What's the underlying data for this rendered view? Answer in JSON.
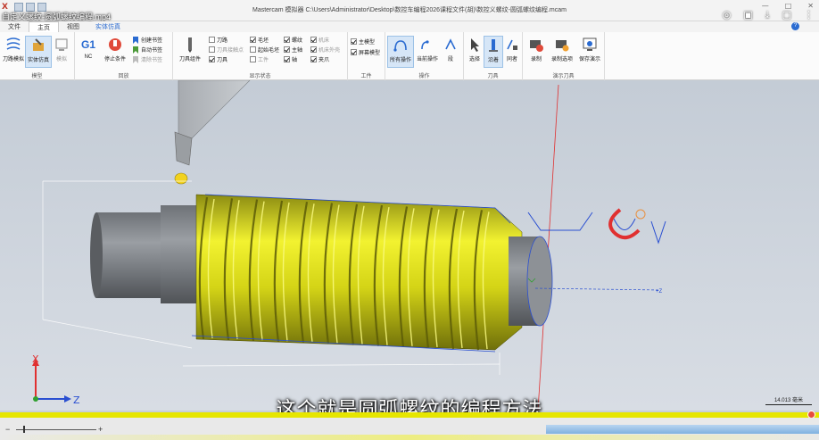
{
  "window": {
    "title": "Mastercam 模拟器  C:\\Users\\Administrator\\Desktop\\数控车编程2026课程文件(胡)\\数控义螺纹-圆弧螺纹编程.mcam",
    "video_title": "自定义螺纹-圆弧螺纹编程.mp4",
    "logo": "X"
  },
  "menu": {
    "tabs": [
      {
        "label": "文件"
      },
      {
        "label": "主页"
      },
      {
        "label": "视图"
      },
      {
        "label": "实体仿真"
      }
    ],
    "help": "?"
  },
  "ribbon": {
    "groups": {
      "model": {
        "label": "模型",
        "toolpath_sim": "刀路模拟",
        "solid_sim": "实体仿真",
        "simulate": "模拟"
      },
      "stop": {
        "label": "回放",
        "g1": "G1",
        "nc": "NC",
        "stop_condition": "停止条件",
        "create_bookmark": "创建书签",
        "auto_bookmark": "自动书签",
        "clear_bookmark": "清除书签"
      },
      "display": {
        "label": "显示状态",
        "tool_group": "刀具组件",
        "tool_path": "刀路",
        "tool_axis": "刀具接触点",
        "tool": "刀具",
        "blank": "毛坯",
        "start_blank": "起始毛坯",
        "workpiece": "工件",
        "fixture": "夹具",
        "thread": "螺纹",
        "spindle": "主轴",
        "machine": "机床",
        "machine_housing": "机床外壳",
        "clamp": "夹爪",
        "axis": "轴"
      },
      "workpiece": {
        "label": "工件",
        "main_model": "主模型",
        "screen_model": "屏幕模型"
      },
      "operation": {
        "label": "操作",
        "all_ops": "所有操作",
        "current_op": "当前操作",
        "step": "段"
      },
      "tool": {
        "label": "刀具",
        "select": "选择",
        "along": "沿着",
        "pass": "同者"
      },
      "record": {
        "label": "演示刀具",
        "record": "录制",
        "record_options": "录制选项",
        "save_demo": "保存演示"
      }
    }
  },
  "viewport": {
    "axis_z_label": "+Z",
    "triad_x": "X",
    "triad_z": "Z",
    "scale_readout": "14.013 毫米"
  },
  "video": {
    "subtitle": "这个就是圆弧螺纹的编程方法",
    "progress": 0.99
  },
  "colors": {
    "thread_yellow": "#e8e814",
    "part_gray": "#7f8388",
    "axis_red": "#e03030",
    "axis_blue": "#2a4fd1",
    "sel_blue": "#d6e6f7"
  }
}
